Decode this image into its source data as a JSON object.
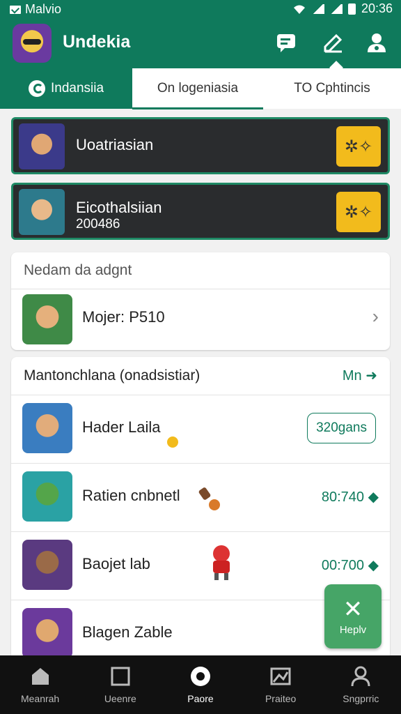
{
  "status_bar": {
    "left_text": "Malvio",
    "time": "20:36"
  },
  "app": {
    "title": "Undekia"
  },
  "tabs": [
    {
      "label": "Indansiia",
      "active": true
    },
    {
      "label": "On logeniasia",
      "active": false
    },
    {
      "label": "TO Cphtincis",
      "active": false
    }
  ],
  "featured": [
    {
      "title": "Uoatriasian",
      "subtitle": ""
    },
    {
      "title": "Eicothalsiian",
      "subtitle": "200486"
    }
  ],
  "recent_card": {
    "header": "Nedam da adgnt",
    "row": {
      "label": "Mojer: P510"
    }
  },
  "list_card": {
    "header": "Mantonchlana (onadsistiar)",
    "more_label": "Mn",
    "rows": [
      {
        "name": "Hader Laila",
        "value": "320gans",
        "value_style": "pill"
      },
      {
        "name": "Ratien cnbnetl",
        "value": "80:740",
        "value_style": "text"
      },
      {
        "name": "Baojet lab",
        "value": "00:700",
        "value_style": "text"
      },
      {
        "name": "Blagen Zable",
        "value": "8",
        "value_style": "text"
      }
    ]
  },
  "fab": {
    "label": "Heplv"
  },
  "bottom_nav": [
    {
      "label": "Meanrah",
      "icon": "home-icon"
    },
    {
      "label": "Ueenre",
      "icon": "square-icon"
    },
    {
      "label": "Paore",
      "icon": "record-icon",
      "active": true
    },
    {
      "label": "Praiteo",
      "icon": "photo-icon"
    },
    {
      "label": "Sngprric",
      "icon": "profile-icon"
    }
  ],
  "colors": {
    "primary": "#0f7a5c",
    "accent": "#f2bb1c",
    "fab": "#46a567",
    "nav_bg": "#111111"
  }
}
